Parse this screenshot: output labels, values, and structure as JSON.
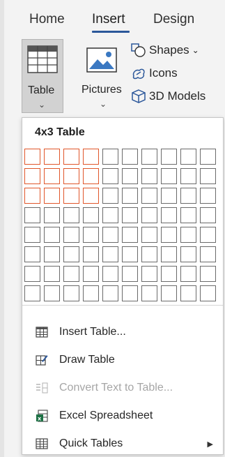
{
  "tabs": [
    {
      "label": "Home"
    },
    {
      "label": "Insert",
      "active": true
    },
    {
      "label": "Design"
    }
  ],
  "ribbon": {
    "table_label": "Table",
    "pictures_label": "Pictures",
    "shapes_label": "Shapes",
    "icons_label": "Icons",
    "models_label": "3D Models",
    "chevron": "⌄"
  },
  "dropdown": {
    "header": "4x3 Table",
    "grid": {
      "columns": 10,
      "rows": 8,
      "selected_columns": 4,
      "selected_rows": 3
    },
    "items": [
      {
        "label": "Insert Table...",
        "icon": "table-grid-icon",
        "enabled": true
      },
      {
        "label": "Draw Table",
        "icon": "draw-table-icon",
        "enabled": true
      },
      {
        "label": "Convert Text to Table...",
        "icon": "convert-text-icon",
        "enabled": false
      },
      {
        "label": "Excel Spreadsheet",
        "icon": "excel-icon",
        "enabled": true
      },
      {
        "label": "Quick Tables",
        "icon": "quick-tables-icon",
        "enabled": true,
        "submenu": true
      }
    ]
  },
  "colors": {
    "accent": "#2b579a",
    "selection": "#e0562a",
    "excel": "#1e7145"
  }
}
